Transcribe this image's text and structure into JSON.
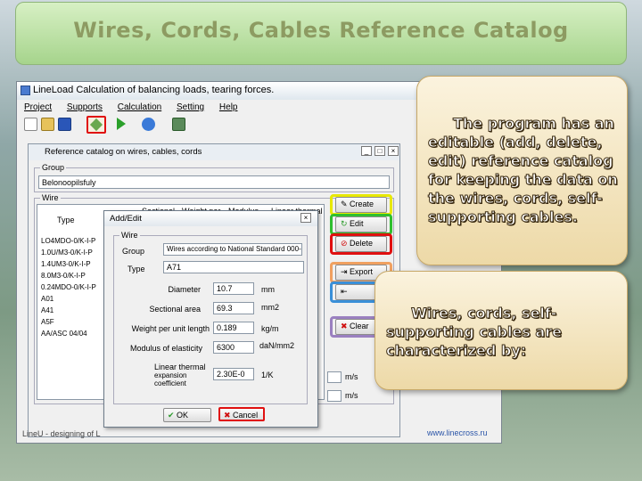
{
  "slide": {
    "title": "Wires, Cords, Cables Reference Catalog"
  },
  "app": {
    "window_title": "LineLoad   Calculation of balancing loads, tearing forces.",
    "menu": [
      "Project",
      "Supports",
      "Calculation",
      "Setting",
      "Help"
    ],
    "status_text": "LineU - designing of L",
    "site": "www.linecross.ru"
  },
  "catalog": {
    "title": "Reference catalog on wires, cables, cords",
    "group_label": "Group",
    "group_value": "Belonoopilsfuly",
    "wire_label": "Wire",
    "columns": [
      "Type",
      "D",
      "Sectional",
      "Weight per",
      "Modulus",
      "Linear thermal"
    ],
    "rows": [
      "LO4MDO-0/K-I-P",
      "1.0U/M3-0/K-I-P",
      "1.4UM3-0/K-I-P",
      "8.0M3-0/K-I-P",
      "0.24MDO-0/K-I-P",
      "A01",
      "A41",
      "A5F",
      "AA/ASC 04/04"
    ],
    "buttons": {
      "create": "Create",
      "edit": "Edit",
      "delete": "Delete",
      "export": "Export",
      "import": "",
      "clear": "Clear"
    },
    "speed_unit_1": "m/s",
    "speed_unit_2": "m/s"
  },
  "dialog": {
    "title": "Add/Edit",
    "wire_label": "Wire",
    "group_label": "Group",
    "group_value": "Wires according to National Standard 000-0",
    "type_label": "Type",
    "type_value": "A71",
    "diameter_label": "Diameter",
    "diameter_value": "10.7",
    "diameter_unit": "mm",
    "area_label": "Sectional area",
    "area_value": "69.3",
    "area_unit": "mm2",
    "weight_label": "Weight per unit length",
    "weight_value": "0.189",
    "weight_unit": "kg/m",
    "modulus_label": "Modulus of elasticity",
    "modulus_value": "6300",
    "modulus_unit": "daN/mm2",
    "thermal_label_1": "Linear thermal",
    "thermal_label_2": "expansion",
    "thermal_label_3": "coefficient",
    "thermal_value": "2.30E-0",
    "thermal_unit": "1/K",
    "ok": "OK",
    "cancel": "Cancel"
  },
  "callouts": {
    "first": "The program has an editable (add, delete, edit) reference catalog for keeping the data on the wires, cords, self-supporting cables.",
    "second": "Wires, cords, self-supporting cables are characterized by:"
  },
  "colors": {
    "highlight_yellow": "#e8e800",
    "highlight_green": "#2fbf2f",
    "highlight_red": "#e01010",
    "highlight_orange": "#f0a060",
    "highlight_blue": "#3a8fd8",
    "highlight_purple": "#9a80c0",
    "toolbar_red_box": "#e01010"
  }
}
